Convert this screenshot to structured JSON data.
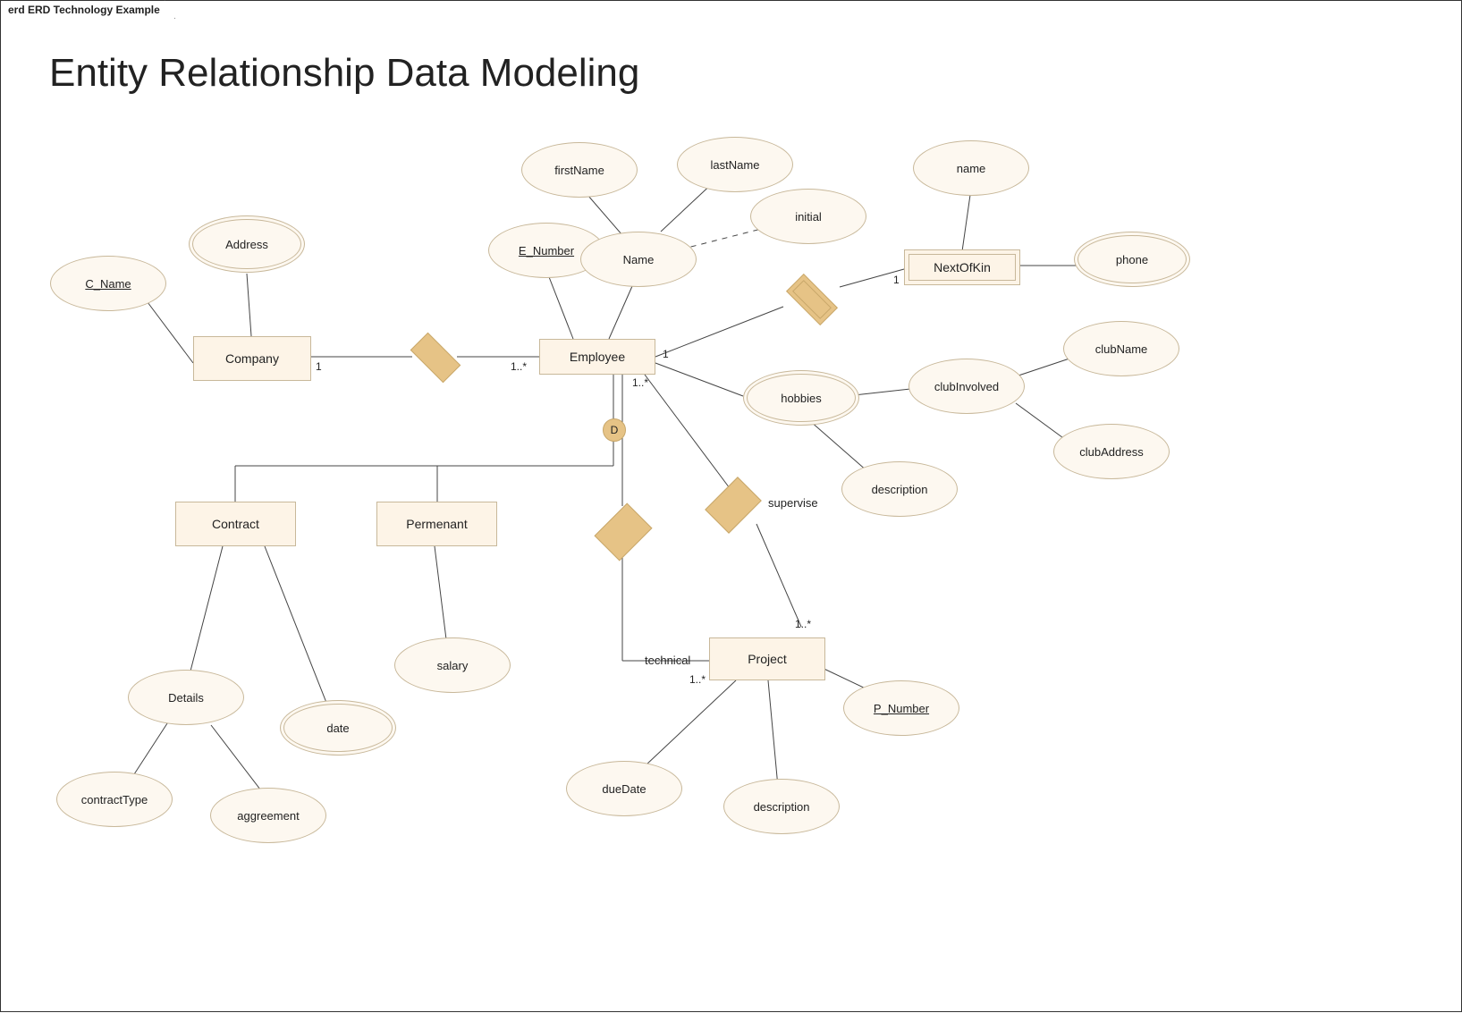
{
  "tab_label": "erd ERD Technology Example",
  "title": "Entity Relationship Data Modeling",
  "entities": {
    "company": "Company",
    "employee": "Employee",
    "nextofkin": "NextOfKin",
    "contract": "Contract",
    "permenant": "Permenant",
    "project": "Project"
  },
  "attributes": {
    "c_name": "C_Name",
    "address": "Address",
    "e_number": "E_Number",
    "name": "Name",
    "firstName": "firstName",
    "lastName": "lastName",
    "initial": "initial",
    "nok_name": "name",
    "phone": "phone",
    "hobbies": "hobbies",
    "clubInvolved": "clubInvolved",
    "clubName": "clubName",
    "clubAddress": "clubAddress",
    "hobbies_description": "description",
    "details": "Details",
    "contractType": "contractType",
    "date": "date",
    "aggreement": "aggreement",
    "salary": "salary",
    "p_number": "P_Number",
    "dueDate": "dueDate",
    "proj_description": "description"
  },
  "relationships": {
    "supervise": "supervise",
    "technical": "technical"
  },
  "cardinalities": {
    "company_side": "1",
    "employee_side_company": "1..*",
    "employee_side_nok": "1",
    "nok_side": "1",
    "employee_side_project": "1..*",
    "project_technical": "1..*",
    "project_supervise": "1..*"
  },
  "disjoint": "D"
}
